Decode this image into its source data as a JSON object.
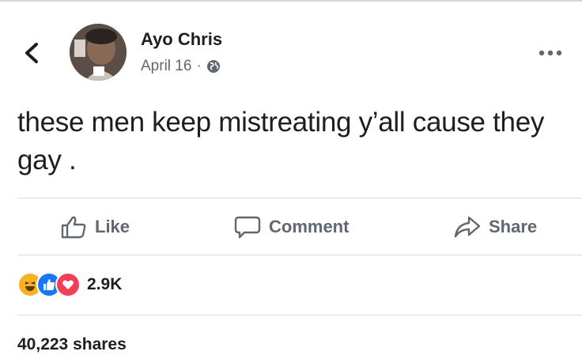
{
  "post": {
    "author": "Ayo Chris",
    "date": "April 16",
    "separator": "·",
    "privacy_icon": "globe-icon",
    "text": "these men keep mistreating y’all cause they gay ."
  },
  "actions": {
    "like_label": "Like",
    "comment_label": "Comment",
    "share_label": "Share"
  },
  "reactions": {
    "icons": [
      "haha-icon",
      "like-icon",
      "love-icon"
    ],
    "count": "2.9K"
  },
  "shares": {
    "label": "40,223 shares"
  },
  "colors": {
    "text": "#1c1e21",
    "secondary": "#606770",
    "like_blue": "#1877f2",
    "love_red": "#f33e58",
    "haha_yellow": "#f7b125"
  }
}
